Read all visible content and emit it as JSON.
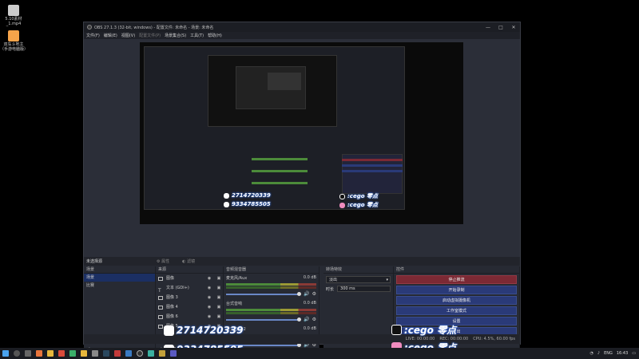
{
  "desktop": {
    "icons": [
      {
        "label": "5.10素材_1.mp4",
        "icon": "video-file-icon"
      },
      {
        "label": "双车斗地主（手游电脑版）",
        "icon": "game-app-icon"
      }
    ]
  },
  "window": {
    "title": "OBS 27.1.3 (32-bit, windows) - 配置文件: 未命名 - 场景: 未命名",
    "controls": [
      "—",
      "□",
      "✕"
    ],
    "menu": [
      {
        "label": "文件(F)",
        "enabled": true
      },
      {
        "label": "编辑(E)",
        "enabled": true
      },
      {
        "label": "视图(V)",
        "enabled": true
      },
      {
        "label": "配置文件(P)",
        "enabled": false
      },
      {
        "label": "场景集合(S)",
        "enabled": true
      },
      {
        "label": "工具(T)",
        "enabled": true
      },
      {
        "label": "帮助(H)",
        "enabled": true
      }
    ]
  },
  "toolbar": {
    "no_source": "未选择源",
    "properties": "属性",
    "filters": "滤镜"
  },
  "docks": {
    "scenes": {
      "title": "场景",
      "items": [
        {
          "label": "场景",
          "selected": true
        },
        {
          "label": "比赛",
          "selected": false
        }
      ],
      "footer": "+ − ∧ ∨"
    },
    "sources": {
      "title": "来源",
      "items": [
        {
          "label": "图像"
        },
        {
          "label": "文本 (GDI+)"
        },
        {
          "label": "图像 3"
        },
        {
          "label": "图像 4"
        },
        {
          "label": "图像 6"
        },
        {
          "label": "图像 5"
        },
        {
          "label": "图像 2"
        }
      ],
      "footer": "+ − ⚙ ∧ ∨"
    },
    "mixer": {
      "title": "音频混音器",
      "channels": [
        {
          "name": "麦克风/Aux",
          "level": "0.0 dB"
        },
        {
          "name": "台式音响",
          "level": "0.0 dB"
        },
        {
          "name": "台式音响 2",
          "level": "0.0 dB"
        }
      ]
    },
    "transitions": {
      "title": "转场特效",
      "selected": "淡出",
      "duration_label": "时长",
      "duration_value": "300 ms"
    },
    "controls": {
      "title": "控件",
      "buttons": [
        {
          "label": "停止推流",
          "style": "stop"
        },
        {
          "label": "开始录制",
          "style": "normal"
        },
        {
          "label": "启动虚拟摄像机",
          "style": "normal"
        },
        {
          "label": "工作室模式",
          "style": "normal"
        },
        {
          "label": "设置",
          "style": "normal"
        },
        {
          "label": "退出",
          "style": "normal"
        }
      ]
    }
  },
  "status": {
    "live": "LIVE: 00:00:00",
    "rec": "REC: 00:00:00",
    "cpu": "CPU: 4.5%, 60.00 fps"
  },
  "overlays": {
    "qq1": "2714720339",
    "qq2": "9334785505",
    "tiktok": ":cego 零点",
    "bilibili": ":cego 零点"
  },
  "taskbar": {
    "tray_lang": "ENG",
    "time": "16:43"
  },
  "colors": {
    "accent": "#2a3a78",
    "stop": "#7c2934",
    "window_bg": "#272a33"
  }
}
